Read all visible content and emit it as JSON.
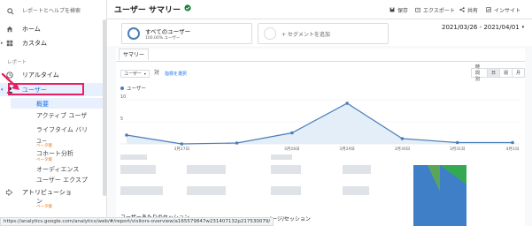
{
  "sidebar": {
    "search_placeholder": "レポートとヘルプを検索",
    "home_label": "ホーム",
    "custom_label": "カスタム",
    "reports_section": "レポート",
    "realtime_label": "リアルタイム",
    "user_label": "ユーザー",
    "sub_items": [
      {
        "label": "概要"
      },
      {
        "label": "アクティブ ユーザ"
      },
      {
        "label": "ライフタイム バリ"
      },
      {
        "label": "ユー"
      },
      {
        "label": "コホート分析"
      },
      {
        "label": "オーディエンス"
      },
      {
        "label": "ユーザー エクスプ"
      },
      {
        "label": "アトリビューショ"
      },
      {
        "label": "ン"
      }
    ],
    "beta_labels": [
      "ベータ版",
      "ベータ版",
      "ベータ版"
    ]
  },
  "header": {
    "title": "ユーザー サマリー",
    "save_label": "保存",
    "export_label": "エクスポート",
    "share_label": "共有",
    "insight_label": "インサイト"
  },
  "segments": {
    "all_users_name": "すべてのユーザー",
    "all_users_sub": "100.00% ユーザー",
    "add_segment": "+ セグメントを追加",
    "date_range": "2021/03/26 - 2021/04/01"
  },
  "tabs": {
    "summary": "サマリー"
  },
  "controls": {
    "metric": "ユーザー",
    "vs": "対",
    "select_metric": "指標を選択",
    "periods": [
      "時間別",
      "日",
      "週",
      "月"
    ],
    "active_period": "日"
  },
  "colors": {
    "accent": "#1a73e8",
    "line": "#4a7ebb",
    "area": "#e3eef8",
    "highlight": "#e91e63",
    "verified": "#188038"
  },
  "chart_data": {
    "type": "area",
    "series": [
      {
        "name": "ユーザー",
        "values": [
          2,
          0,
          0.2,
          2.5,
          9.2,
          1.2,
          0.3,
          0.3
        ]
      }
    ],
    "x": [
      "",
      "3月27日",
      "",
      "3月28日",
      "3月29日",
      "3月30日",
      "3月31日",
      "4月1日"
    ],
    "y_ticks": [
      "10",
      "5"
    ],
    "ylim": [
      0,
      10
    ],
    "grid": true
  },
  "bottom": {
    "label_sessions": "ユーザーあたりのセッション",
    "label_pages": "ページ/セッション"
  },
  "status_url": "https://analytics.google.com/analytics/web/#/report/visitors-overview/a165579847w231407132p217530079/"
}
